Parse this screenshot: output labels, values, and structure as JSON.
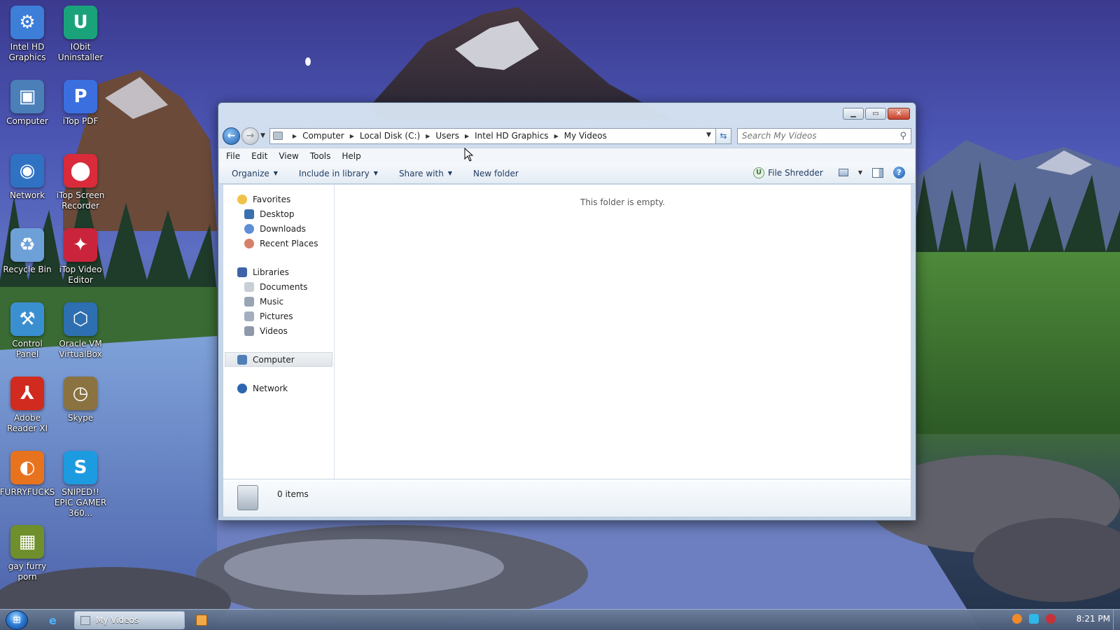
{
  "desktop": {
    "icons": [
      {
        "label": "Intel HD Graphics",
        "icon": "intel-graphics-icon",
        "color": "#3d7ed8"
      },
      {
        "label": "IObit Uninstaller",
        "icon": "iobit-uninstaller-icon",
        "color": "#1aa37a"
      },
      {
        "label": "Computer",
        "icon": "computer-icon",
        "color": "#4a7fb8"
      },
      {
        "label": "iTop PDF",
        "icon": "itop-pdf-icon",
        "color": "#3b6fe0"
      },
      {
        "label": "Network",
        "icon": "network-icon",
        "color": "#2f72c4"
      },
      {
        "label": "iTop Screen Recorder",
        "icon": "itop-screen-recorder-icon",
        "color": "#d92b3a"
      },
      {
        "label": "Recycle Bin",
        "icon": "recycle-bin-icon",
        "color": "#6ea0d8"
      },
      {
        "label": "iTop Video Editor",
        "icon": "itop-video-editor-icon",
        "color": "#c9243b"
      },
      {
        "label": "Control Panel",
        "icon": "control-panel-icon",
        "color": "#3a8fd0"
      },
      {
        "label": "Oracle VM VirtualBox",
        "icon": "virtualbox-icon",
        "color": "#2d6fb0"
      },
      {
        "label": "Adobe Reader XI",
        "icon": "adobe-reader-icon",
        "color": "#d12a1e"
      },
      {
        "label": "Skype",
        "icon": "skype-clock-icon",
        "color": "#8a7340"
      },
      {
        "label": "FURRYFUCKS",
        "icon": "firefox-icon",
        "color": "#e8731f"
      },
      {
        "label": "SNIPED!! EPIC GAMER 360...",
        "icon": "skype-icon",
        "color": "#1d9be0"
      },
      {
        "label": "gay furry porn",
        "icon": "box-game-icon",
        "color": "#6e8f2c"
      }
    ]
  },
  "window": {
    "caption": {
      "minimize": "minimize-button",
      "maximize": "maximize-button",
      "close": "close-button"
    },
    "address": {
      "crumbs": [
        "Computer",
        "Local Disk (C:)",
        "Users",
        "Intel HD Graphics",
        "My Videos"
      ]
    },
    "search": {
      "placeholder": "Search My Videos"
    },
    "menu": [
      "File",
      "Edit",
      "View",
      "Tools",
      "Help"
    ],
    "commands": [
      "Organize",
      "Include in library",
      "Share with",
      "New folder"
    ],
    "file_shredder": "File Shredder",
    "nav": {
      "favorites": {
        "label": "Favorites",
        "items": [
          "Desktop",
          "Downloads",
          "Recent Places"
        ]
      },
      "libraries": {
        "label": "Libraries",
        "items": [
          "Documents",
          "Music",
          "Pictures",
          "Videos"
        ]
      },
      "computer": "Computer",
      "network": "Network"
    },
    "empty_message": "This folder is empty.",
    "status_count": "0 items"
  },
  "taskbar": {
    "task_label": "My Videos",
    "clock": "8:21 PM"
  },
  "colors": {
    "accent": "#2a6cb8",
    "close": "#c8402a"
  }
}
